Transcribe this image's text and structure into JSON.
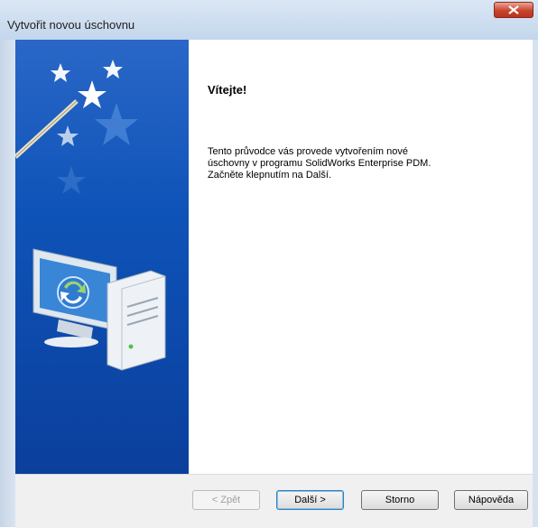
{
  "window": {
    "title": "Vytvořit novou úschovnu"
  },
  "content": {
    "heading": "Vítejte!",
    "description_lines": [
      "Tento průvodce vás provede vytvořením nové",
      "úschovny v programu SolidWorks Enterprise PDM.",
      "Začněte klepnutím na Další."
    ]
  },
  "buttons": {
    "back": "< Zpět",
    "next": "Další >",
    "cancel": "Storno",
    "help": "Nápověda"
  },
  "icons": [
    "close-icon",
    "magic-wand-icon",
    "computer-sync-icon"
  ],
  "colors": {
    "banner": "#0e53b8",
    "close": "#c8452d"
  }
}
